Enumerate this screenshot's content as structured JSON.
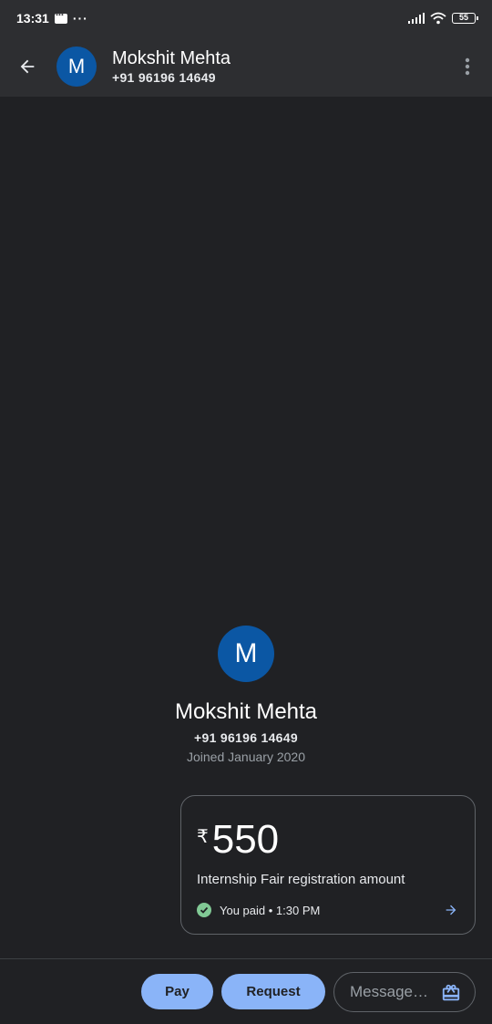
{
  "status_bar": {
    "time": "13:31",
    "battery": "55"
  },
  "header": {
    "avatar_letter": "M",
    "name": "Mokshit Mehta",
    "phone": "+91 96196 14649"
  },
  "profile": {
    "avatar_letter": "M",
    "name": "Mokshit Mehta",
    "phone": "+91 96196 14649",
    "joined": "Joined January 2020"
  },
  "payment_card": {
    "currency_symbol": "₹",
    "amount": "550",
    "note": "Internship Fair registration amount",
    "status": "You paid • 1:30 PM"
  },
  "bottom_bar": {
    "pay_label": "Pay",
    "request_label": "Request",
    "message_placeholder": "Message…"
  },
  "colors": {
    "accent": "#8ab4f8",
    "avatar": "#0b57a4",
    "success": "#81c995",
    "background": "#202124"
  }
}
